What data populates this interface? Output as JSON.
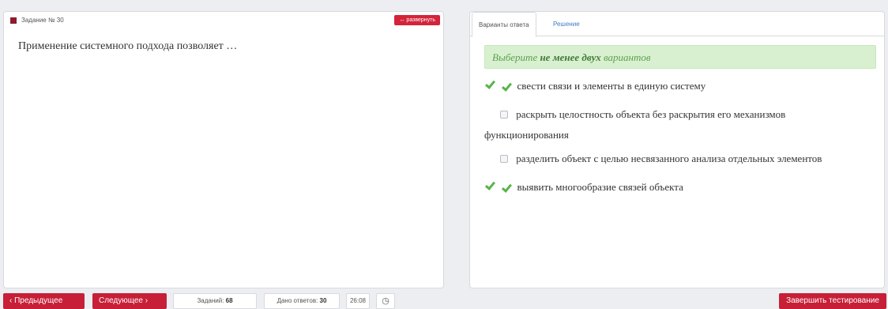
{
  "task": {
    "label": "Задание № 30",
    "expand_label": "↔ развернуть",
    "question": "Применение системного подхода позволяет …"
  },
  "tabs": {
    "answers": "Варианты ответа",
    "solution": "Решение"
  },
  "hint": {
    "prefix": "Выберите",
    "bold": "не менее двух",
    "suffix": "вариантов"
  },
  "options": [
    {
      "text": "свести связи и элементы в единую систему",
      "checked": true,
      "correct": true
    },
    {
      "text": "раскрыть целостность объекта без раскрытия его механизмов",
      "checked": false,
      "correct": false
    },
    {
      "text_cont": "функционирования"
    },
    {
      "text": "разделить объект с целью несвязанного анализа отдельных элементов",
      "checked": false,
      "correct": false
    },
    {
      "text": "выявить многообразие связей объекта",
      "checked": true,
      "correct": true
    }
  ],
  "footer": {
    "prev": "‹ Предыдущее",
    "next": "Следующее ›",
    "tasks_label": "Заданий:",
    "tasks_count": "68",
    "answered_label": "Дано ответов:",
    "answered_count": "30",
    "timer": "26:08",
    "finish": "Завершить тестирование"
  },
  "colors": {
    "accent": "#c71f37",
    "success": "#5bb34a",
    "hint_bg": "#d9f0d0"
  },
  "icons": {
    "check": "checkmark-icon",
    "clock": "clock-icon",
    "expand": "expand-arrows-icon"
  }
}
